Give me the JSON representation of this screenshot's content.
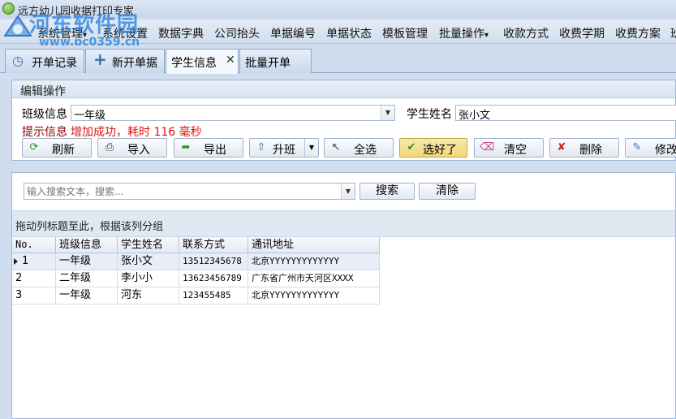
{
  "window": {
    "title": "远方幼儿园收据打印专家"
  },
  "watermark": {
    "text": "河东软件园",
    "url": "www.pc0359.cn"
  },
  "menu": {
    "items": [
      "系统管理",
      "系统设置",
      "数据字典",
      "公司抬头",
      "单据编号",
      "单据状态",
      "模板管理",
      "批量操作",
      "收款方式",
      "收费学期",
      "收费方案",
      "班"
    ],
    "dropdown_marker": "▾"
  },
  "tabs": [
    {
      "label": "开单记录",
      "icon": "history-icon"
    },
    {
      "label": "新开单据",
      "icon": "plus-icon"
    },
    {
      "label": "学生信息",
      "active": true,
      "close": "✕"
    },
    {
      "label": "批量开单"
    }
  ],
  "edit_group": {
    "title": "编辑操作",
    "class_label": "班级信息",
    "class_value": "一年级",
    "student_label": "学生姓名",
    "student_value": "张小文",
    "hint_label": "提示信息",
    "hint_value": "增加成功，耗时 116 毫秒",
    "hint_color": "#e01010",
    "buttons": [
      {
        "label": "刷新",
        "icon": "refresh-icon"
      },
      {
        "label": "导入",
        "icon": "import-icon"
      },
      {
        "label": "导出",
        "icon": "export-icon"
      },
      {
        "label": "升班",
        "icon": "promote-icon"
      },
      {
        "label": "全选",
        "icon": "cursor-icon"
      },
      {
        "label": "选好了",
        "icon": "check-icon"
      },
      {
        "label": "清空",
        "icon": "eraser-icon"
      },
      {
        "label": "删除",
        "icon": "delete-icon"
      },
      {
        "label": "修改",
        "icon": "edit-icon"
      }
    ]
  },
  "search": {
    "placeholder": "输入搜索文本，搜索...",
    "search_label": "搜索",
    "clear_label": "清除"
  },
  "grid": {
    "group_hint": "拖动列标题至此，根据该列分组",
    "columns": [
      "No.",
      "班级信息",
      "学生姓名",
      "联系方式",
      "通讯地址"
    ],
    "rows": [
      {
        "no": "1",
        "class": "一年级",
        "name": "张小文",
        "phone": "13512345678",
        "address": "北京YYYYYYYYYYYYY",
        "current": true
      },
      {
        "no": "2",
        "class": "二年级",
        "name": "李小小",
        "phone": "13623456789",
        "address": "广东省广州市天河区XXXX"
      },
      {
        "no": "3",
        "class": "一年级",
        "name": "河东",
        "phone": "123455485",
        "address": "北京YYYYYYYYYYYYY"
      }
    ]
  }
}
